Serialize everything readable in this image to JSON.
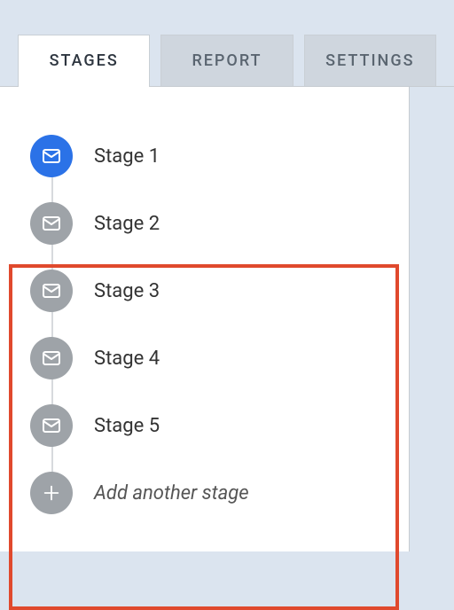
{
  "tabs": {
    "stages": "STAGES",
    "report": "REPORT",
    "settings": "SETTINGS"
  },
  "stages": {
    "s1": "Stage 1",
    "s2": "Stage 2",
    "s3": "Stage 3",
    "s4": "Stage 4",
    "s5": "Stage 5"
  },
  "add_label": "Add another stage",
  "colors": {
    "active_node": "#2b72e7",
    "inactive_node": "#9ea3a8",
    "highlight": "#e0492d"
  }
}
